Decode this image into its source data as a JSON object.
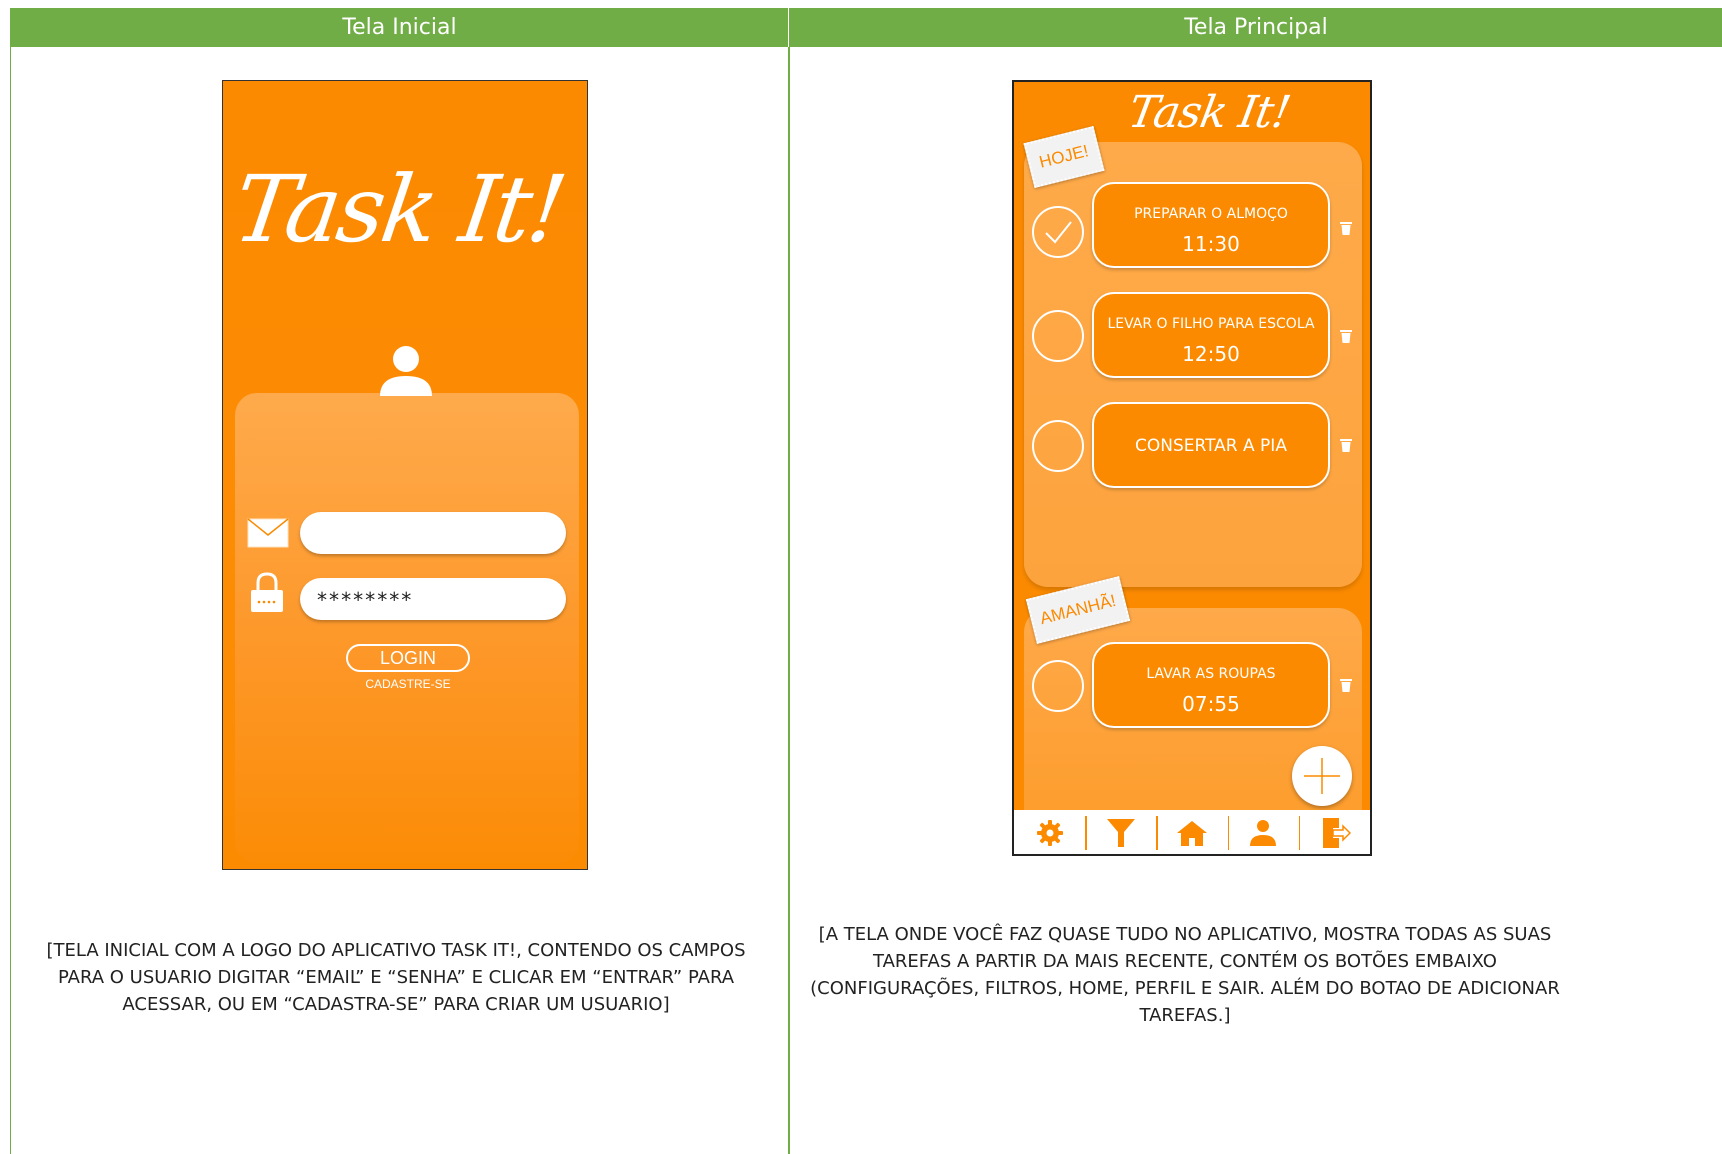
{
  "table": {
    "col1_header": "Tela Inicial",
    "col2_header": "Tela Principal",
    "col1_caption": "[TELA INICIAL COM A LOGO DO APLICATIVO TASK IT!, CONTENDO OS CAMPOS PARA O USUARIO DIGITAR “EMAIL” E “SENHA” E CLICAR EM “ENTRAR” PARA ACESSAR, OU EM “CADASTRA-SE” PARA CRIAR UM USUARIO]",
    "col2_caption": "[A TELA ONDE VOCÊ FAZ QUASE TUDO NO APLICATIVO, MOSTRA TODAS AS SUAS TAREFAS A PARTIR DA MAIS RECENTE, CONTÉM OS BOTÕES EMBAIXO (CONFIGURAÇÕES, FILTROS, HOME, PERFIL E SAIR. ALÉM DO BOTAO DE ADICIONAR TAREFAS.]"
  },
  "login_screen": {
    "logo": "Task It!",
    "email_value": "",
    "password_value": "********",
    "login_label": "LOGIN",
    "signup_label": "CADASTRE-SE"
  },
  "main_screen": {
    "logo": "Task It!",
    "sections": [
      {
        "label": "HOJE!",
        "tasks": [
          {
            "title": "PREPARAR O ALMOÇO",
            "time": "11:30",
            "done": true
          },
          {
            "title": "LEVAR O FILHO PARA ESCOLA",
            "time": "12:50",
            "done": false
          },
          {
            "title": "CONSERTAR A PIA",
            "time": "",
            "done": false
          }
        ]
      },
      {
        "label": "AMANHÃ!",
        "tasks": [
          {
            "title": "LAVAR AS ROUPAS",
            "time": "07:55",
            "done": false
          }
        ]
      }
    ],
    "nav_icons": [
      "gear-icon",
      "filter-icon",
      "home-icon",
      "user-icon",
      "logout-icon"
    ]
  },
  "colors": {
    "accent": "#fb8a00",
    "header_green": "#70ad47"
  }
}
